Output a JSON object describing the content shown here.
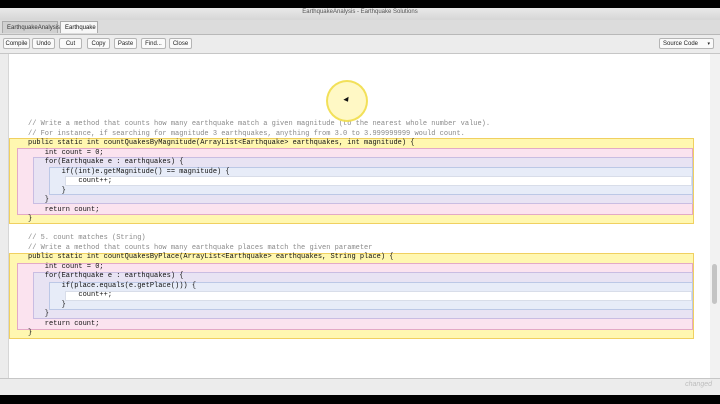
{
  "window": {
    "title": "EarthquakeAnalysis - Earthquake Solutions"
  },
  "tabs": [
    {
      "label": "EarthquakeAnalysis"
    },
    {
      "label": "Earthquake"
    }
  ],
  "toolbar": {
    "compile": "Compile",
    "undo": "Undo",
    "cut": "Cut",
    "copy": "Copy",
    "paste": "Paste",
    "find": "Find...",
    "close": "Close",
    "view_select": "Source Code"
  },
  "code_lines": [
    "// Write a method that counts how many earthquake match a given magnitude (to the nearest whole number value).",
    "// For instance, if searching for magnitude 3 earthquakes, anything from 3.0 to 3.999999999 would count.",
    "public static int countQuakesByMagnitude(ArrayList<Earthquake> earthquakes, int magnitude) {",
    "    int count = 0;",
    "    for(Earthquake e : earthquakes) {",
    "        if((int)e.getMagnitude() == magnitude) {",
    "            count++;",
    "        }",
    "    }",
    "    return count;",
    "}",
    "",
    "// 5. count matches (String)",
    "// Write a method that counts how many earthquake places match the given parameter",
    "public static int countQuakesByPlace(ArrayList<Earthquake> earthquakes, String place) {",
    "    int count = 0;",
    "    for(Earthquake e : earthquakes) {",
    "        if(place.equals(e.getPlace())) {",
    "            count++;",
    "        }",
    "    }",
    "    return count;",
    "}"
  ],
  "status": {
    "watermark": "changed"
  }
}
